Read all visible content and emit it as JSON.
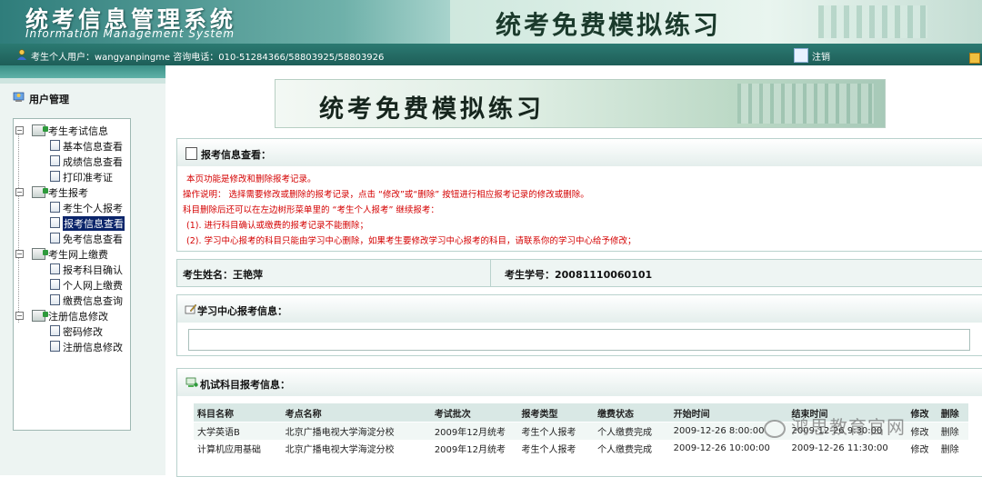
{
  "header": {
    "title": "统考信息管理系统",
    "subtitle": "Information Management System",
    "banner": "统考免费模拟练习"
  },
  "topbar": {
    "user_text": "考生个人用户：wangyanpingme 咨询电话：010-51284366/58803925/58803926",
    "logout": "注销"
  },
  "sidebar": {
    "heading": "用户管理",
    "tree": [
      {
        "label": "考生考试信息",
        "children": [
          "基本信息查看",
          "成绩信息查看",
          "打印准考证"
        ]
      },
      {
        "label": "考生报考",
        "children": [
          "考生个人报考",
          "报考信息查看",
          "免考信息查看"
        ]
      },
      {
        "label": "考生网上缴费",
        "children": [
          "报考科目确认",
          "个人网上缴费",
          "缴费信息查询"
        ]
      },
      {
        "label": "注册信息修改",
        "children": [
          "密码修改",
          "注册信息修改"
        ]
      }
    ],
    "selected": "报考信息查看"
  },
  "main": {
    "banner": "统考免费模拟练习",
    "info_panel": {
      "title": "报考信息查看：",
      "notes": [
        "本页功能是修改和删除报考记录。",
        "操作说明：  选择需要修改或删除的报考记录，点击 “修改”或“删除” 按钮进行相应报考记录的修改或删除。",
        "科目删除后还可以在左边树形菜单里的 “考生个人报考” 继续报考：",
        "(1).  进行科目确认或缴费的报考记录不能删除；",
        "(2).  学习中心报考的科目只能由学习中心删除，如果考生要修改学习中心报考的科目，请联系你的学习中心给予修改；"
      ]
    },
    "student": {
      "name_label": "考生姓名：王艳萍",
      "id_label": "考生学号：20081110060101"
    },
    "center_panel": {
      "title": "学习中心报考信息："
    },
    "exam_panel": {
      "title": "机试科目报考信息：",
      "columns": [
        "科目名称",
        "考点名称",
        "考试批次",
        "报考类型",
        "缴费状态",
        "开始时间",
        "结束时间",
        "修改",
        "删除"
      ],
      "rows": [
        [
          "大学英语B",
          "北京广播电视大学海淀分校",
          "2009年12月统考",
          "考生个人报考",
          "个人缴费完成",
          "2009-12-26 8:00:00",
          "2009-12-26 9:30:00",
          "修改",
          "删除"
        ],
        [
          "计算机应用基础",
          "北京广播电视大学海淀分校",
          "2009年12月统考",
          "考生个人报考",
          "个人缴费完成",
          "2009-12-26 10:00:00",
          "2009-12-26 11:30:00",
          "修改",
          "删除"
        ]
      ]
    }
  },
  "watermark": "鸿思教育官网"
}
